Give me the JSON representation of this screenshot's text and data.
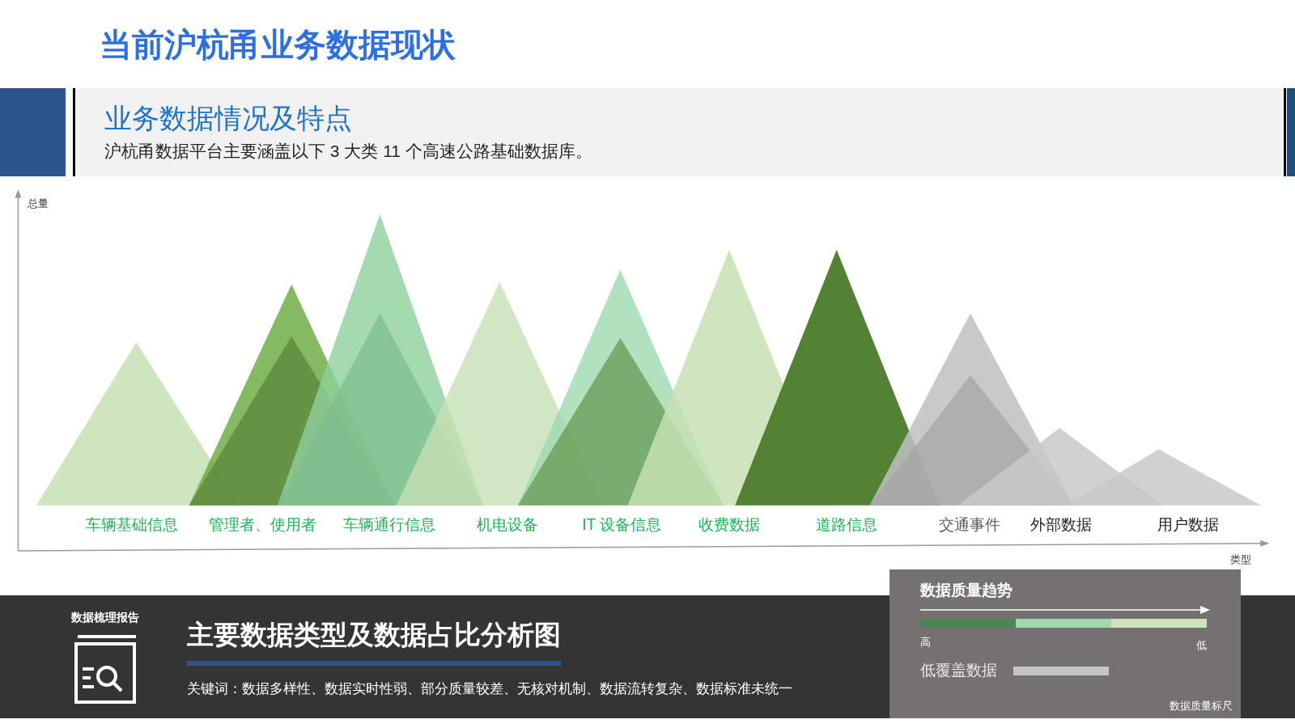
{
  "page_title": "当前沪杭甬业务数据现状",
  "section": {
    "title": "业务数据情况及特点",
    "subtitle": "沪杭甬数据平台主要涵盖以下 3 大类 11 个高速公路基础数据库。"
  },
  "chart": {
    "y_axis_label": "总量",
    "x_axis_label": "类型",
    "categories": [
      {
        "label": "车辆基础信息",
        "color": "#1fb25a"
      },
      {
        "label": "管理者、使用者",
        "color": "#1fb25a"
      },
      {
        "label": "车辆通行信息",
        "color": "#1fb25a"
      },
      {
        "label": "机电设备",
        "color": "#1fb25a"
      },
      {
        "label": "IT 设备信息",
        "color": "#1fb25a"
      },
      {
        "label": "收费数据",
        "color": "#1fb25a"
      },
      {
        "label": "道路信息",
        "color": "#1fb25a"
      },
      {
        "label": "交通事件",
        "color": "#595959"
      },
      {
        "label": "外部数据",
        "color": "#262626"
      },
      {
        "label": "用户数据",
        "color": "#262626"
      }
    ]
  },
  "footer": {
    "icon_label": "数据梳理报告",
    "title": "主要数据类型及数据占比分析图",
    "keywords": "关键词：数据多样性、数据实时性弱、部分质量较差、无核对机制、数据流转复杂、数据标准未统一"
  },
  "quality_panel": {
    "title": "数据质量趋势",
    "scale_segments": [
      {
        "color": "#4a8558"
      },
      {
        "color": "#a0d8b0"
      },
      {
        "color": "#cde4bc"
      }
    ],
    "high_label": "高",
    "low_label": "低",
    "legend": [
      {
        "label": "低覆盖数据",
        "color": "#c4c4c4"
      }
    ],
    "caption": "数据质量标尺"
  }
}
